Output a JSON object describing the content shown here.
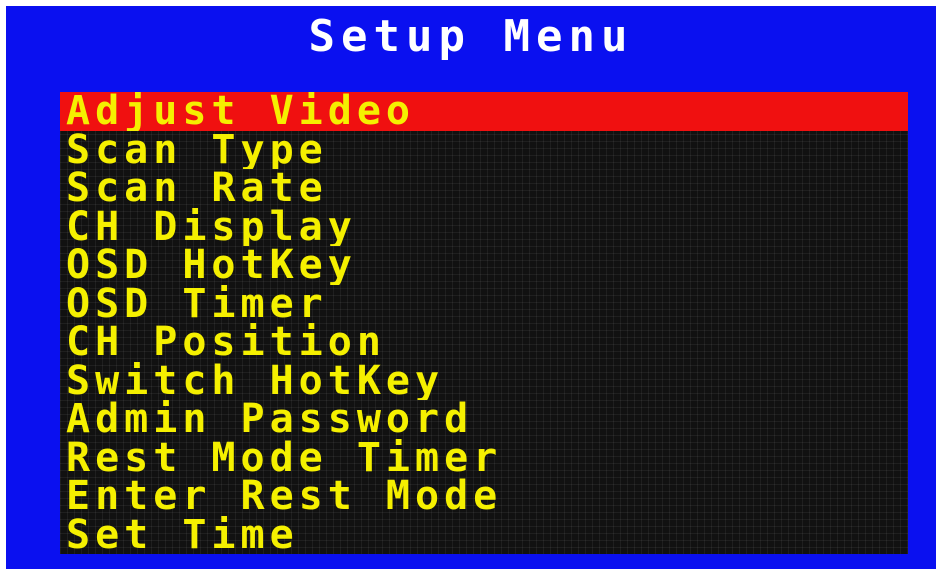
{
  "title": "Setup Menu",
  "colors": {
    "frame_background": "#0a10f0",
    "panel_background": "#111111",
    "item_text": "#f5f000",
    "selected_background": "#f01010",
    "title_text": "#ffffff"
  },
  "menu": {
    "selected_index": 0,
    "items": [
      {
        "label": "Adjust Video"
      },
      {
        "label": "Scan Type"
      },
      {
        "label": "Scan Rate"
      },
      {
        "label": "CH Display"
      },
      {
        "label": "OSD HotKey"
      },
      {
        "label": "OSD Timer"
      },
      {
        "label": "CH Position"
      },
      {
        "label": "Switch HotKey"
      },
      {
        "label": "Admin Password"
      },
      {
        "label": "Rest Mode Timer"
      },
      {
        "label": "Enter Rest Mode"
      },
      {
        "label": "Set Time"
      }
    ]
  }
}
